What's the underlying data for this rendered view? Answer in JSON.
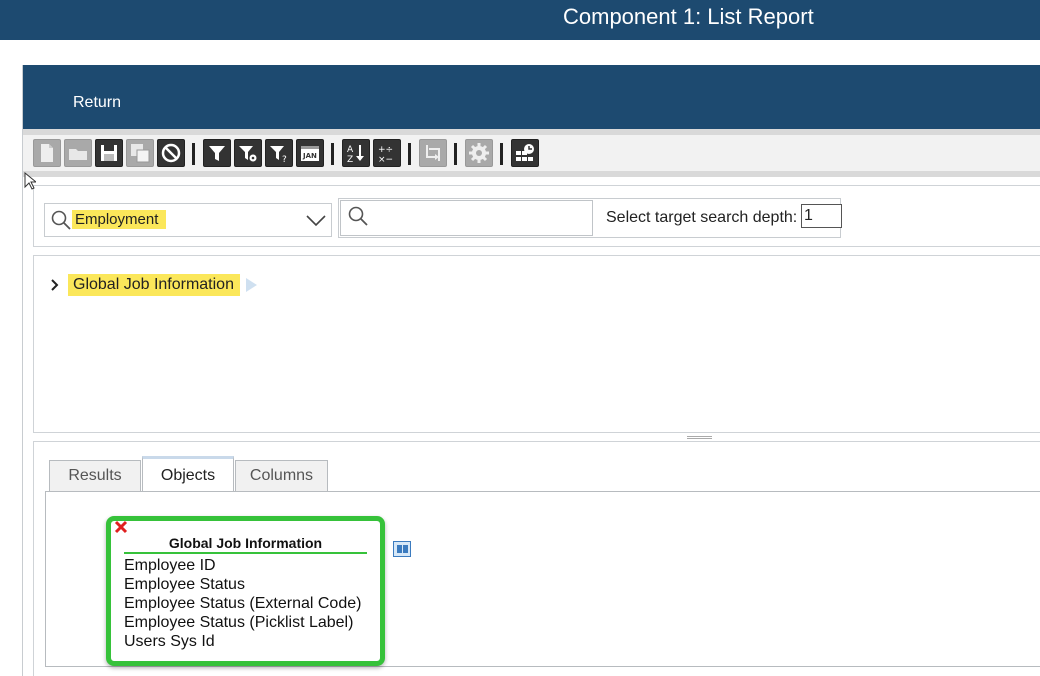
{
  "window": {
    "title": "Component 1: List Report"
  },
  "header": {
    "return_label": "Return"
  },
  "toolbar": {
    "buttons": [
      {
        "name": "new-document-button",
        "icon": "document-icon",
        "enabled": false
      },
      {
        "name": "open-folder-button",
        "icon": "folder-icon",
        "enabled": false
      },
      {
        "name": "save-button",
        "icon": "floppy-icon",
        "enabled": true
      },
      {
        "name": "save-as-button",
        "icon": "floppy-copy-icon",
        "enabled": false
      },
      {
        "name": "cancel-button",
        "icon": "no-entry-icon",
        "enabled": true
      },
      {
        "name": "filter-button",
        "icon": "filter-icon",
        "enabled": true
      },
      {
        "name": "filter-settings-button",
        "icon": "filter-gear-icon",
        "enabled": true
      },
      {
        "name": "filter-prompt-button",
        "icon": "filter-question-icon",
        "enabled": true
      },
      {
        "name": "date-filter-button",
        "icon": "calendar-jan-icon",
        "enabled": true
      },
      {
        "name": "sort-button",
        "icon": "sort-az-icon",
        "enabled": true
      },
      {
        "name": "calculation-button",
        "icon": "plus-minus-times-icon",
        "enabled": true
      },
      {
        "name": "join-button",
        "icon": "join-arrows-icon",
        "enabled": false
      },
      {
        "name": "settings-button",
        "icon": "gear-icon",
        "enabled": false
      },
      {
        "name": "schedule-button",
        "icon": "grid-clock-icon",
        "enabled": true
      }
    ]
  },
  "search": {
    "category_value": "Employment",
    "query_value": "",
    "depth_label": "Select target search depth:",
    "depth_value": "1"
  },
  "tree": {
    "nodes": [
      {
        "label": "Global Job Information",
        "expanded": false
      }
    ]
  },
  "tabs": [
    {
      "label": "Results",
      "active": false
    },
    {
      "label": "Objects",
      "active": true
    },
    {
      "label": "Columns",
      "active": false
    }
  ],
  "object_card": {
    "title": "Global Job Information",
    "fields": [
      "Employee ID",
      "Employee Status",
      "Employee Status (External Code)",
      "Employee Status (Picklist Label)",
      "Users Sys Id"
    ]
  },
  "colors": {
    "header_bg": "#1d4a70",
    "highlight": "#fbe75a",
    "card_border": "#36c23a"
  }
}
